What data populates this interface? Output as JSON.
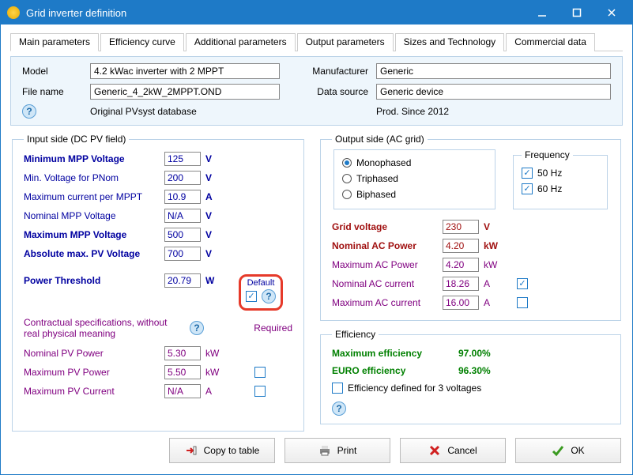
{
  "window": {
    "title": "Grid inverter definition"
  },
  "tabs": [
    "Main parameters",
    "Efficiency curve",
    "Additional parameters",
    "Output parameters",
    "Sizes and Technology",
    "Commercial data"
  ],
  "header": {
    "model_lbl": "Model",
    "model": "4.2 kWac inverter with 2 MPPT",
    "file_lbl": "File name",
    "file": "Generic_4_2kW_2MPPT.OND",
    "mfr_lbl": "Manufacturer",
    "mfr": "Generic",
    "src_lbl": "Data source",
    "src": "Generic device",
    "orig": "Original PVsyst database",
    "prod": "Prod. Since 2012"
  },
  "input": {
    "legend": "Input side (DC PV field)",
    "min_mpp_lbl": "Minimum MPP Voltage",
    "min_mpp": "125",
    "min_pnom_lbl": "Min. Voltage for PNom",
    "min_pnom": "200",
    "max_i_mppt_lbl": "Maximum current per MPPT",
    "max_i_mppt": "10.9",
    "nom_mpp_lbl": "Nominal MPP Voltage",
    "nom_mpp": "N/A",
    "max_mpp_lbl": "Maximum MPP Voltage",
    "max_mpp": "500",
    "abs_max_lbl": "Absolute max. PV Voltage",
    "abs_max": "700",
    "pthr_lbl": "Power Threshold",
    "pthr": "20.79",
    "default_lbl": "Default",
    "contract": "Contractual specifications, without real physical meaning",
    "required": "Required",
    "nom_pv_p_lbl": "Nominal PV Power",
    "nom_pv_p": "5.30",
    "max_pv_p_lbl": "Maximum PV Power",
    "max_pv_p": "5.50",
    "max_pv_i_lbl": "Maximum PV Current",
    "max_pv_i": "N/A",
    "u_V": "V",
    "u_A": "A",
    "u_W": "W",
    "u_kW": "kW"
  },
  "output": {
    "legend": "Output side (AC grid)",
    "mono": "Monophased",
    "tri": "Triphased",
    "bi": "Biphased",
    "freq_legend": "Frequency",
    "hz50": "50 Hz",
    "hz60": "60 Hz",
    "grid_v_lbl": "Grid voltage",
    "grid_v": "230",
    "nom_ac_p_lbl": "Nominal AC Power",
    "nom_ac_p": "4.20",
    "max_ac_p_lbl": "Maximum AC Power",
    "max_ac_p": "4.20",
    "nom_ac_i_lbl": "Nominal AC current",
    "nom_ac_i": "18.26",
    "max_ac_i_lbl": "Maximum AC current",
    "max_ac_i": "16.00",
    "u_V": "V",
    "u_A": "A",
    "u_kW": "kW"
  },
  "eff": {
    "legend": "Efficiency",
    "max_lbl": "Maximum efficiency",
    "max": "97.00%",
    "euro_lbl": "EURO efficiency",
    "euro": "96.30%",
    "per3v": "Efficiency defined for 3 voltages"
  },
  "buttons": {
    "copy": "Copy to table",
    "print": "Print",
    "cancel": "Cancel",
    "ok": "OK"
  }
}
